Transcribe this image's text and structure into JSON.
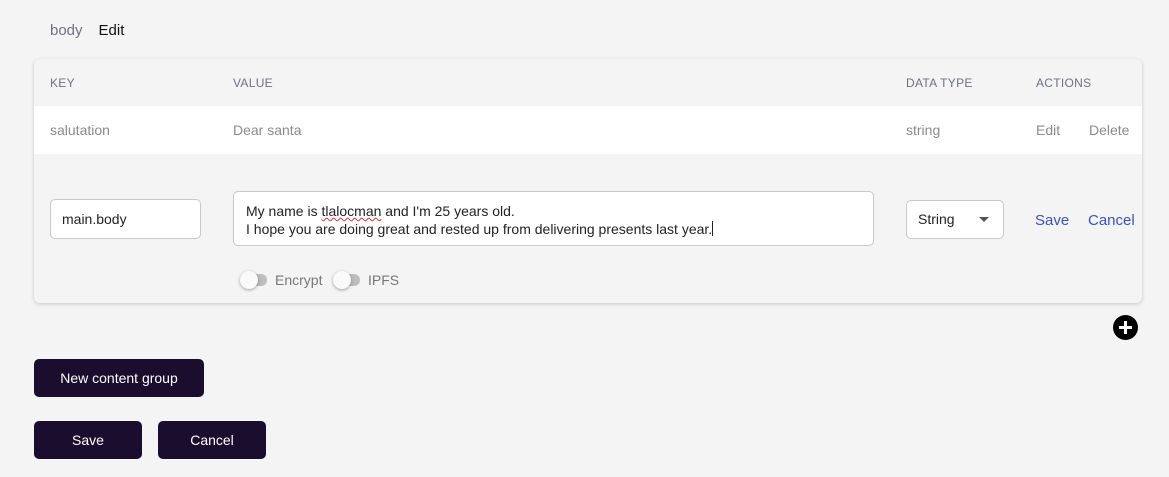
{
  "breadcrumb": {
    "parent": "body",
    "current": "Edit"
  },
  "table": {
    "headers": {
      "key": "KEY",
      "value": "VALUE",
      "data_type": "DATA TYPE",
      "actions": "ACTIONS"
    },
    "rows": [
      {
        "key": "salutation",
        "value": "Dear santa",
        "data_type": "string",
        "edit_label": "Edit",
        "delete_label": "Delete"
      }
    ],
    "editing_row": {
      "key": "main.body",
      "value_line1_prefix": "My name is ",
      "value_line1_misspelled": "tlalocman",
      "value_line1_suffix": " and I'm 25 years old.",
      "value_line2": "I hope you are doing great and rested up from delivering presents last year.",
      "data_type": "String",
      "save_label": "Save",
      "cancel_label": "Cancel",
      "encrypt_label": "Encrypt",
      "encrypt_on": false,
      "ipfs_label": "IPFS",
      "ipfs_on": false
    }
  },
  "add_icon": "plus-circle-icon",
  "buttons": {
    "new_content_group": "New content group",
    "save": "Save",
    "cancel": "Cancel"
  },
  "colors": {
    "button_bg": "#1a0d2e",
    "link_blue": "#3b4fc4",
    "delete_red": "#dd3333"
  }
}
